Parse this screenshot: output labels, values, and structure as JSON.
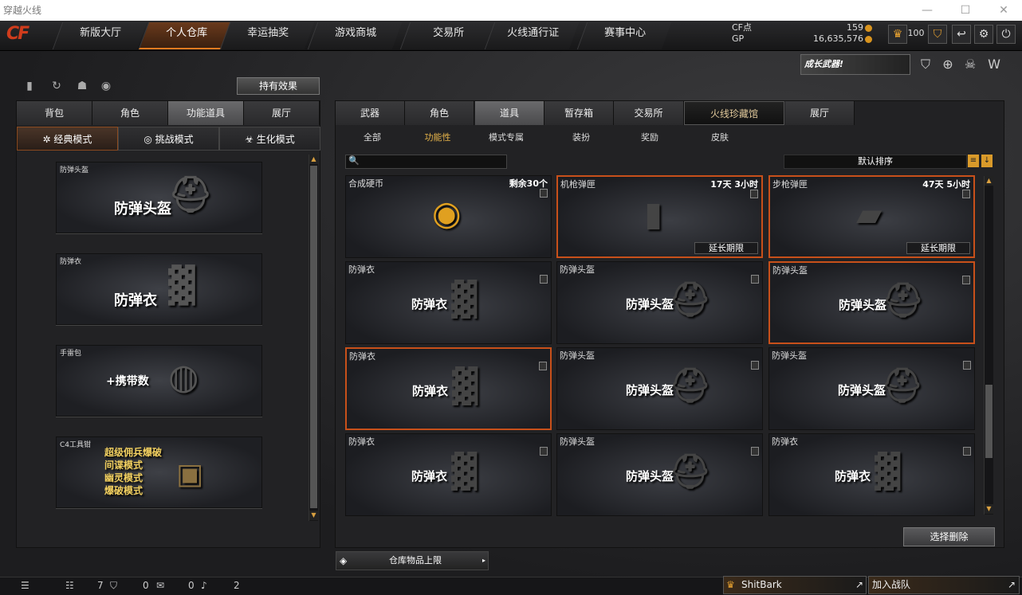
{
  "window": {
    "title": "穿越火线",
    "minimize": "—",
    "maximize": "☐",
    "close": "✕"
  },
  "logo": "CF",
  "nav": {
    "tabs": [
      "新版大厅",
      "个人仓库",
      "幸运抽奖",
      "游戏商城",
      "交易所",
      "火线通行证",
      "赛事中心"
    ],
    "active": "个人仓库"
  },
  "currency": {
    "cf_label": "CF点",
    "cf_value": "159",
    "gp_label": "GP",
    "gp_value": "16,635,576"
  },
  "top_right": {
    "level": "100"
  },
  "banner": {
    "text": "成长武器!"
  },
  "left": {
    "hold_effect_button": "持有效果",
    "tabs": [
      "背包",
      "角色",
      "功能道具",
      "展厅"
    ],
    "active_tab": "功能道具",
    "modes": [
      "经典模式",
      "挑战模式",
      "生化模式"
    ],
    "active_mode": "经典模式",
    "cards": [
      {
        "name": "防弹头盔",
        "big": "防弹头盔"
      },
      {
        "name": "防弹衣",
        "big": "防弹衣"
      },
      {
        "name": "手雷包",
        "big": "+携带数"
      },
      {
        "name": "C4工具钳",
        "lines": [
          "超级佣兵爆破",
          "间谍模式",
          "幽灵模式",
          "爆破模式"
        ]
      }
    ]
  },
  "right": {
    "tabs": [
      "武器",
      "角色",
      "道具",
      "暂存箱",
      "交易所",
      "火线珍藏馆",
      "展厅"
    ],
    "active_tab": "道具",
    "subtabs": [
      "全部",
      "功能性",
      "模式专属",
      "装扮",
      "奖励",
      "皮肤"
    ],
    "active_subtab": "功能性",
    "search_icon": "🔍",
    "sort_label": "默认排序",
    "items": [
      {
        "name": "合成硬币",
        "time": "剩余30个",
        "big": "",
        "img": "coin",
        "selected": false
      },
      {
        "name": "机枪弹匣",
        "time": "17天 3小时",
        "big": "",
        "img": "mag",
        "ext": "延长期限",
        "selected": true
      },
      {
        "name": "步枪弹匣",
        "time": "47天 5小时",
        "big": "",
        "img": "mag2",
        "ext": "延长期限",
        "selected": true
      },
      {
        "name": "防弹衣",
        "time": "",
        "big": "防弹衣",
        "img": "vest",
        "selected": false
      },
      {
        "name": "防弹头盔",
        "time": "",
        "big": "防弹头盔",
        "img": "helmet",
        "selected": false
      },
      {
        "name": "防弹头盔",
        "time": "",
        "big": "防弹头盔",
        "img": "helmet",
        "selected": true
      },
      {
        "name": "防弹衣",
        "time": "",
        "big": "防弹衣",
        "img": "vest",
        "selected": true
      },
      {
        "name": "防弹头盔",
        "time": "",
        "big": "防弹头盔",
        "img": "helmet",
        "selected": false
      },
      {
        "name": "防弹头盔",
        "time": "",
        "big": "防弹头盔",
        "img": "helmet",
        "selected": false
      },
      {
        "name": "防弹衣",
        "time": "",
        "big": "防弹衣",
        "img": "vest",
        "selected": false
      },
      {
        "name": "防弹头盔",
        "time": "",
        "big": "防弹头盔",
        "img": "helmet",
        "selected": false
      },
      {
        "name": "防弹衣",
        "time": "",
        "big": "防弹衣",
        "img": "vest",
        "selected": false
      }
    ],
    "select_delete_button": "选择删除",
    "capacity_label": "仓库物品上限"
  },
  "status": {
    "friends": "7",
    "shield": "0",
    "chat": "0",
    "sound": "2",
    "user": "ShitBark",
    "join": "加入战队"
  }
}
